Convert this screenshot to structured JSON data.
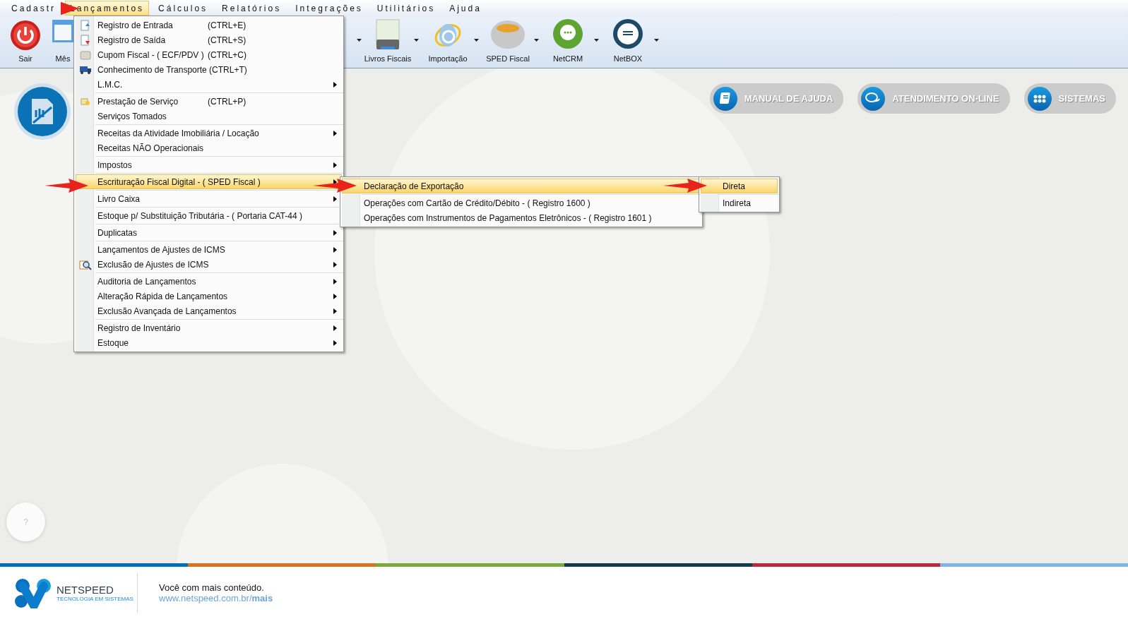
{
  "menu_bar": [
    {
      "label": "Cadastr",
      "selected": false
    },
    {
      "label": "Lançamentos",
      "selected": true
    },
    {
      "label": "Cálculos",
      "selected": false
    },
    {
      "label": "Relatórios",
      "selected": false
    },
    {
      "label": "Integrações",
      "selected": false
    },
    {
      "label": "Utilitários",
      "selected": false
    },
    {
      "label": "Ajuda",
      "selected": false
    }
  ],
  "toolbar": {
    "left": [
      {
        "label": "Sair"
      },
      {
        "label": "Mês"
      }
    ],
    "right": [
      {
        "label": "Livros Fiscais"
      },
      {
        "label": "Importação"
      },
      {
        "label": "SPED Fiscal"
      },
      {
        "label": "NetCRM"
      },
      {
        "label": "NetBOX"
      }
    ]
  },
  "dropdown": [
    {
      "items": [
        {
          "label": "Registro de Entrada",
          "shortcut": "(CTRL+E)",
          "submenu": false,
          "selected": false
        },
        {
          "label": "Registro de Saída",
          "shortcut": "(CTRL+S)",
          "submenu": false,
          "selected": false
        },
        {
          "label": "Cupom Fiscal - ( ECF/PDV )",
          "shortcut": "(CTRL+C)",
          "submenu": false,
          "selected": false
        },
        {
          "label": "Conhecimento de Transporte (CTRL+T)",
          "submenu": false,
          "selected": false
        },
        {
          "label": "L.M.C.",
          "submenu": true,
          "selected": false
        }
      ]
    },
    {
      "items": [
        {
          "label": "Prestação de Serviço",
          "shortcut": "(CTRL+P)",
          "submenu": false,
          "selected": false
        },
        {
          "label": "Serviços Tomados",
          "submenu": false,
          "selected": false
        }
      ]
    },
    {
      "items": [
        {
          "label": "Receitas da Atividade Imobiliária / Locação",
          "submenu": true,
          "selected": false
        },
        {
          "label": "Receitas NÃO Operacionais",
          "submenu": false,
          "selected": false
        }
      ]
    },
    {
      "items": [
        {
          "label": "Impostos",
          "submenu": true,
          "selected": false
        }
      ]
    },
    {
      "items": [
        {
          "label": "Escrituração Fiscal Digital - ( SPED Fiscal )",
          "submenu": true,
          "selected": true
        }
      ]
    },
    {
      "items": [
        {
          "label": "Livro Caixa",
          "submenu": true,
          "selected": false
        }
      ]
    },
    {
      "items": [
        {
          "label": "Estoque p/ Substituição Tributária - ( Portaria CAT-44 )",
          "submenu": false,
          "selected": false
        }
      ]
    },
    {
      "items": [
        {
          "label": "Duplicatas",
          "submenu": true,
          "selected": false
        }
      ]
    },
    {
      "items": [
        {
          "label": "Lançamentos de Ajustes de ICMS",
          "submenu": true,
          "selected": false
        },
        {
          "label": "Exclusão de Ajustes de ICMS",
          "submenu": true,
          "selected": false
        }
      ]
    },
    {
      "items": [
        {
          "label": "Auditoria de Lançamentos",
          "submenu": true,
          "selected": false
        },
        {
          "label": "Alteração Rápida de Lançamentos",
          "submenu": true,
          "selected": false
        },
        {
          "label": "Exclusão Avançada de Lançamentos",
          "submenu": true,
          "selected": false
        }
      ]
    },
    {
      "items": [
        {
          "label": "Registro de Inventário",
          "submenu": true,
          "selected": false
        },
        {
          "label": "Estoque",
          "submenu": true,
          "selected": false
        }
      ]
    }
  ],
  "submenu": [
    {
      "items": [
        {
          "label": "Declaração de Exportação",
          "selected": true
        }
      ]
    },
    {
      "items": [
        {
          "label": "Operações com Cartão de Crédito/Débito - ( Registro 1600 )",
          "selected": false
        },
        {
          "label": "Operações com Instrumentos de Pagamentos Eletrônicos - ( Registro 1601 )",
          "selected": false
        }
      ]
    }
  ],
  "submenu_2": [
    {
      "label": "Direta",
      "selected": true
    },
    {
      "label": "Indireta",
      "selected": false
    }
  ],
  "quick_buttons": [
    {
      "label": "MANUAL DE AJUDA",
      "kind": "book"
    },
    {
      "label": "ATENDIMENTO ON-LINE",
      "kind": "chat"
    },
    {
      "label": "SISTEMAS",
      "kind": "grid"
    }
  ],
  "help_button": {
    "label": "?"
  },
  "footer": {
    "logo_name": "NETSPEED",
    "logo_tagline": "TECNOLOGIA EM SISTEMAS",
    "text": "Você com mais conteúdo.",
    "link_prefix": "www.netspeed.com.br/",
    "link_bold": "mais"
  }
}
